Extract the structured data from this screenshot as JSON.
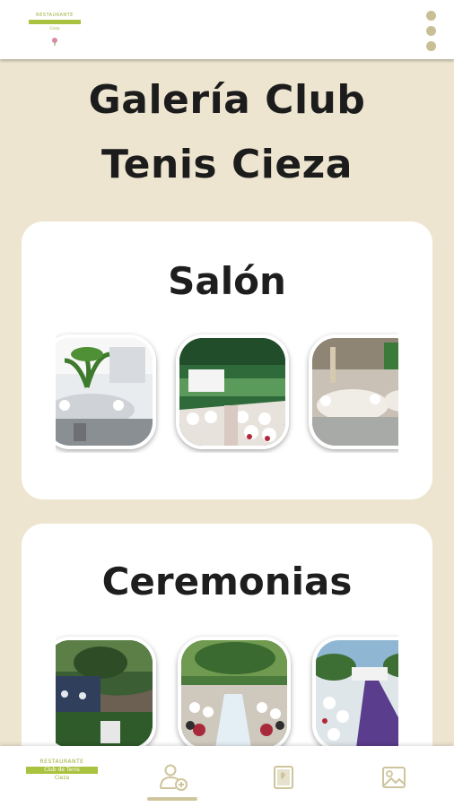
{
  "header": {
    "logo_line1": "RESTAURANTE",
    "logo_line2": "Club de Tenis",
    "logo_line3": "Cieza",
    "menu_icon": "kebab-menu-icon"
  },
  "page": {
    "title_line1": "Galería Club",
    "title_line2": "Tenis Cieza"
  },
  "sections": [
    {
      "title": "Salón",
      "photos": [
        "salon-photo-1",
        "salon-photo-2",
        "salon-photo-3"
      ]
    },
    {
      "title": "Ceremonias",
      "photos": [
        "ceremonias-photo-1",
        "ceremonias-photo-2",
        "ceremonias-photo-3"
      ]
    }
  ],
  "bottom_nav": {
    "logo_line1": "RESTAURANTE",
    "logo_line2": "Club de Tenis",
    "logo_line3": "Cieza",
    "items": [
      {
        "icon": "user-add-icon",
        "active": true
      },
      {
        "icon": "menu-book-icon",
        "active": false
      },
      {
        "icon": "gallery-icon",
        "active": false
      }
    ]
  },
  "colors": {
    "background": "#ede5d0",
    "accent": "#cfc59c",
    "brand_green": "#a9c23f"
  }
}
